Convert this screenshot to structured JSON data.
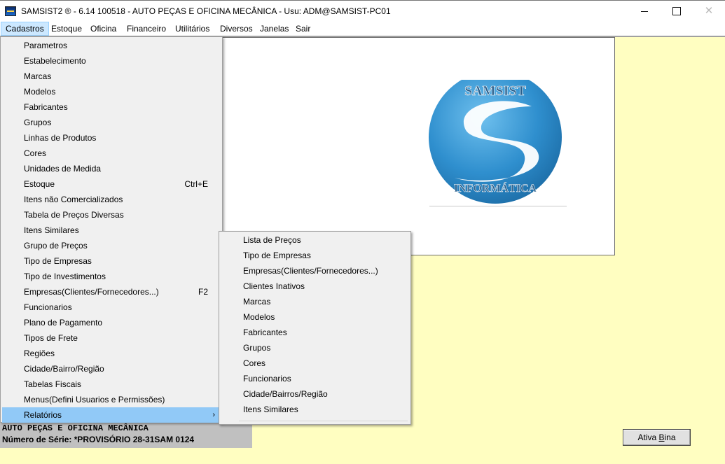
{
  "window": {
    "title": "SAMSIST2 ® - 6.14  100518 - AUTO PEÇAS E OFICINA MECÂNICA - Usu: ADM@SAMSIST-PC01",
    "close_glyph": "✕"
  },
  "menubar": [
    {
      "label": "Cadastros"
    },
    {
      "label": "Estoque"
    },
    {
      "label": "Oficina"
    },
    {
      "label": "Financeiro"
    },
    {
      "label": "Utilitários"
    },
    {
      "label": "Diversos"
    },
    {
      "label": "Janelas"
    },
    {
      "label": "Sair"
    }
  ],
  "cadastros_menu": [
    {
      "label": "Parametros",
      "shortcut": ""
    },
    {
      "label": "Estabelecimento",
      "shortcut": ""
    },
    {
      "label": "Marcas",
      "shortcut": ""
    },
    {
      "label": "Modelos",
      "shortcut": ""
    },
    {
      "label": "Fabricantes",
      "shortcut": ""
    },
    {
      "label": "Grupos",
      "shortcut": ""
    },
    {
      "label": "Linhas de Produtos",
      "shortcut": ""
    },
    {
      "label": "Cores",
      "shortcut": ""
    },
    {
      "label": "Unidades de Medida",
      "shortcut": ""
    },
    {
      "label": "Estoque",
      "shortcut": "Ctrl+E"
    },
    {
      "label": "Itens não Comercializados",
      "shortcut": ""
    },
    {
      "label": "Tabela de Preços Diversas",
      "shortcut": ""
    },
    {
      "label": "Itens Similares",
      "shortcut": ""
    },
    {
      "label": "Grupo de Preços",
      "shortcut": ""
    },
    {
      "label": "Tipo de Empresas",
      "shortcut": ""
    },
    {
      "label": "Tipo de Investimentos",
      "shortcut": ""
    },
    {
      "label": "Empresas(Clientes/Fornecedores...)",
      "shortcut": "F2"
    },
    {
      "label": "Funcionarios",
      "shortcut": ""
    },
    {
      "label": "Plano de Pagamento",
      "shortcut": ""
    },
    {
      "label": "Tipos de Frete",
      "shortcut": ""
    },
    {
      "label": "Regiões",
      "shortcut": ""
    },
    {
      "label": "Cidade/Bairro/Região",
      "shortcut": ""
    },
    {
      "label": "Tabelas Fiscais",
      "shortcut": ""
    },
    {
      "label": "Menus(Defini Usuarios e Permissões)",
      "shortcut": ""
    },
    {
      "label": "Relatórios",
      "shortcut": "",
      "submenu": true
    }
  ],
  "relatorios_menu": [
    {
      "label": "Lista de Preços"
    },
    {
      "label": "Tipo de Empresas"
    },
    {
      "label": "Empresas(Clientes/Fornecedores...)"
    },
    {
      "label": "Clientes Inativos"
    },
    {
      "label": "Marcas"
    },
    {
      "label": "Modelos"
    },
    {
      "label": "Fabricantes"
    },
    {
      "label": "Grupos"
    },
    {
      "label": "Cores"
    },
    {
      "label": "Funcionarios"
    },
    {
      "label": "Cidade/Bairros/Região"
    },
    {
      "label": "Itens Similares"
    }
  ],
  "logo": {
    "top_text": "SAMSIST",
    "bottom_text": "INFORMÁTICA",
    "color": "#2e8ccb"
  },
  "status": {
    "company": "AUTO PEÇAS E OFICINA MECÂNICA",
    "serial": "Número de Série: *PROVISÓRIO 28-31SAM    0124"
  },
  "bina_button": {
    "label_prefix": "Ativa ",
    "label_accel": "B",
    "label_suffix": "ina"
  },
  "colors": {
    "background": "#fffec1",
    "menu_highlight": "#91c9f7",
    "menubar_active": "#cce8ff"
  }
}
